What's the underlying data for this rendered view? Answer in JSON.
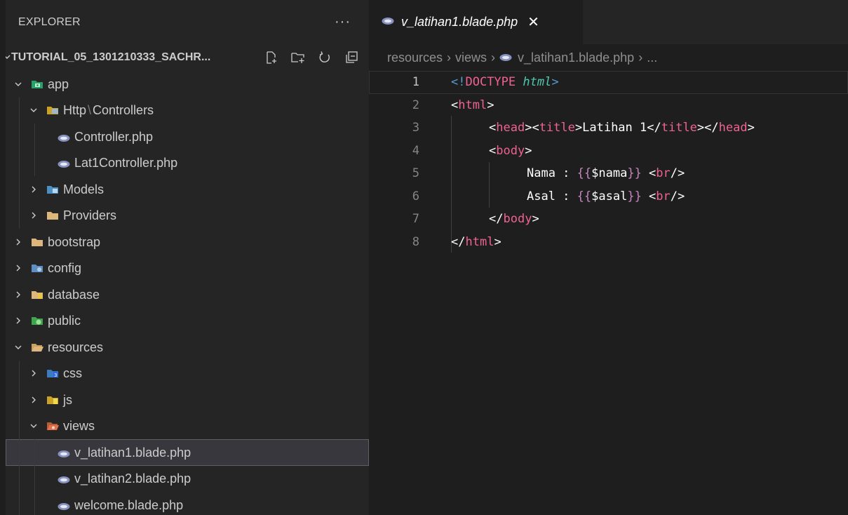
{
  "sidebar": {
    "title": "EXPLORER",
    "more": "···",
    "workspace": "TUTORIAL_05_1301210333_SACHR...",
    "actions": [
      "new-file-icon",
      "new-folder-icon",
      "refresh-icon",
      "collapse-all-icon"
    ],
    "tree": [
      {
        "label": "app",
        "expanded": true,
        "icon": "folder-app-icon"
      },
      {
        "label": "Http",
        "label2": "Controllers",
        "expanded": true,
        "icon": "folder-http-icon"
      },
      {
        "label": "Controller.php",
        "icon": "php-file-icon"
      },
      {
        "label": "Lat1Controller.php",
        "icon": "php-file-icon"
      },
      {
        "label": "Models",
        "expanded": false,
        "icon": "folder-models-icon"
      },
      {
        "label": "Providers",
        "expanded": false,
        "icon": "folder-icon"
      },
      {
        "label": "bootstrap",
        "expanded": false,
        "icon": "folder-icon"
      },
      {
        "label": "config",
        "expanded": false,
        "icon": "folder-config-icon"
      },
      {
        "label": "database",
        "expanded": false,
        "icon": "folder-database-icon"
      },
      {
        "label": "public",
        "expanded": false,
        "icon": "folder-public-icon"
      },
      {
        "label": "resources",
        "expanded": true,
        "icon": "folder-open-icon"
      },
      {
        "label": "css",
        "expanded": false,
        "icon": "folder-css-icon"
      },
      {
        "label": "js",
        "expanded": false,
        "icon": "folder-js-icon"
      },
      {
        "label": "views",
        "expanded": true,
        "icon": "folder-views-icon"
      },
      {
        "label": "v_latihan1.blade.php",
        "icon": "php-file-icon",
        "selected": true
      },
      {
        "label": "v_latihan2.blade.php",
        "icon": "php-file-icon"
      },
      {
        "label": "welcome.blade.php",
        "icon": "php-file-icon"
      }
    ]
  },
  "editor": {
    "tab": {
      "label": "v_latihan1.blade.php",
      "close": "✕"
    },
    "breadcrumb": [
      "resources",
      "views",
      "v_latihan1.blade.php",
      "..."
    ],
    "breadcrumb_sep": "›",
    "line_numbers": [
      "1",
      "2",
      "3",
      "4",
      "5",
      "6",
      "7",
      "8"
    ],
    "code": {
      "l1": {
        "a": "<!",
        "b": "DOCTYPE",
        "c": " ",
        "d": "html",
        "e": ">"
      },
      "l2": {
        "a": "<",
        "b": "html",
        "c": ">"
      },
      "l3": {
        "a": "<",
        "b": "head",
        "c": "><",
        "d": "title",
        "e": ">",
        "f": "Latihan 1",
        "g": "</",
        "h": "title",
        "i": "></",
        "j": "head",
        "k": ">"
      },
      "l4": {
        "a": "<",
        "b": "body",
        "c": ">"
      },
      "l5": {
        "a": "Nama : ",
        "b": "{{",
        "c": "$nama",
        "d": "}}",
        "e": " <",
        "f": "br",
        "g": "/>"
      },
      "l6": {
        "a": "Asal : ",
        "b": "{{",
        "c": "$asal",
        "d": "}}",
        "e": " <",
        "f": "br",
        "g": "/>"
      },
      "l7": {
        "a": "</",
        "b": "body",
        "c": ">"
      },
      "l8": {
        "a": "</",
        "b": "html",
        "c": ">"
      }
    }
  },
  "colors": {
    "sidebar_bg": "#252526",
    "editor_bg": "#1e1e1e",
    "selection_bg": "#37373d",
    "tag_pink": "#f06292",
    "blade_brace": "#d7ba7d"
  }
}
